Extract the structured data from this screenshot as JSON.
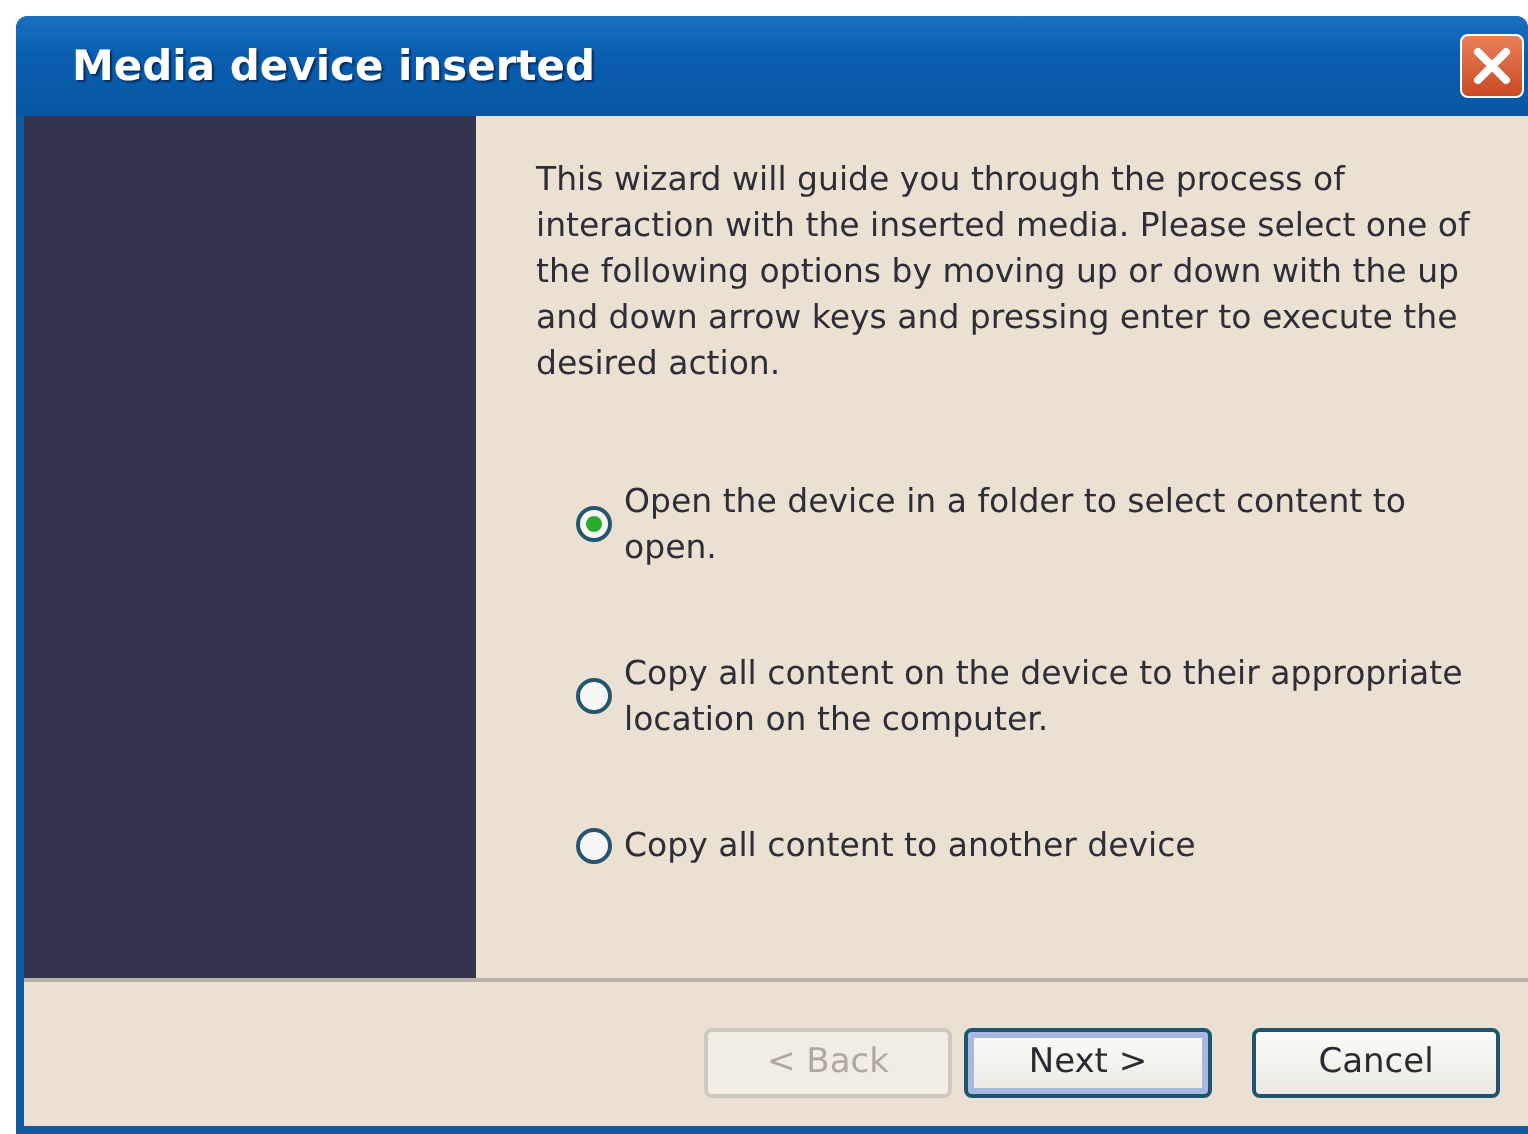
{
  "window": {
    "title": "Media device inserted"
  },
  "intro": "This wizard will guide you through the process of interaction with the inserted media. Please select one of the following options by moving up or down with the up and down arrow keys and pressing enter to execute the desired action.",
  "options": [
    {
      "label": "Open the device in a folder to select content to open.",
      "selected": true
    },
    {
      "label": "Copy all content on the device to their appropriate\n location on the computer.",
      "selected": false
    },
    {
      "label": "Copy all content to another device",
      "selected": false
    }
  ],
  "buttons": [
    {
      "label": "< Back",
      "disabled": true,
      "default": false
    },
    {
      "label": "Next >",
      "disabled": false,
      "default": true
    },
    {
      "label": "Cancel",
      "disabled": false,
      "default": false
    }
  ]
}
